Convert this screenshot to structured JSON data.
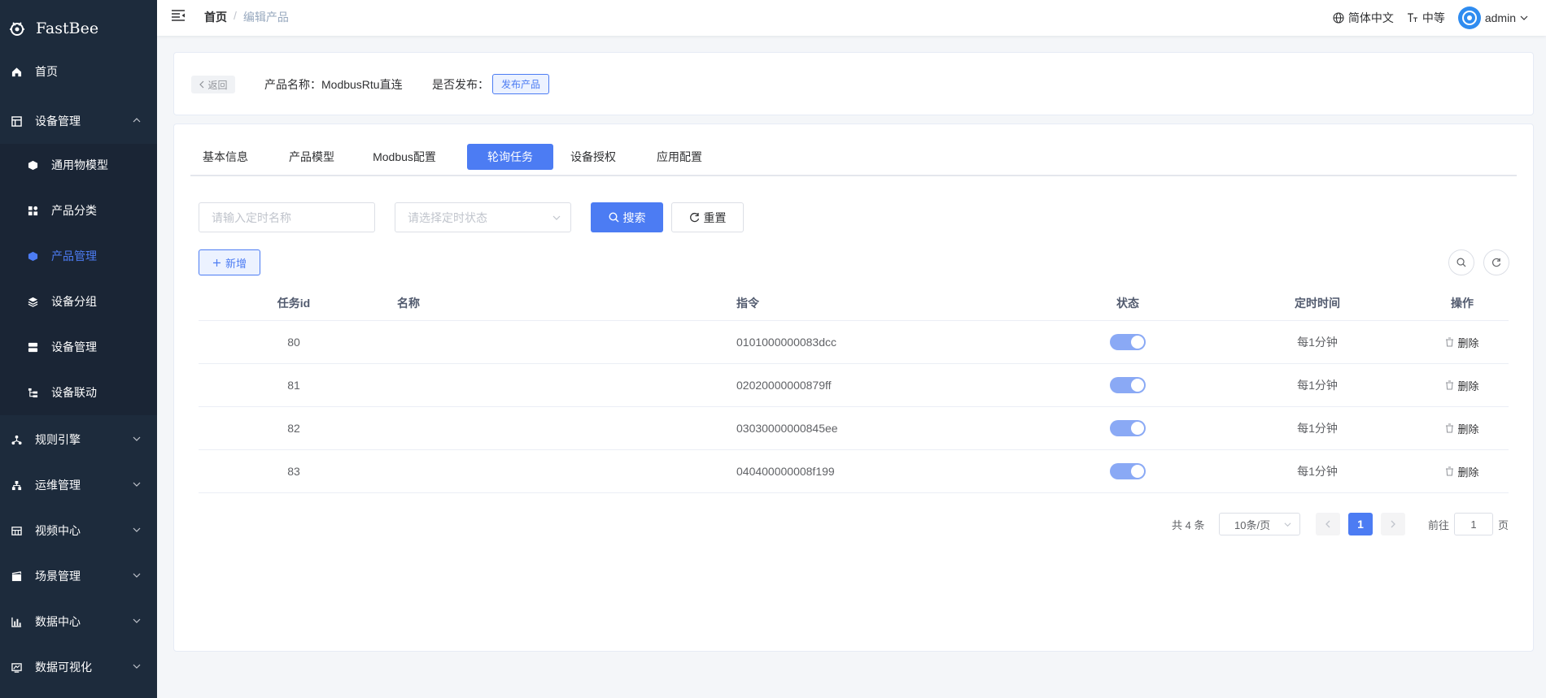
{
  "app": {
    "name": "FastBee"
  },
  "sidebar": {
    "items": [
      {
        "label": "首页",
        "icon": "home-icon"
      },
      {
        "label": "设备管理",
        "icon": "device-icon",
        "expanded": true
      },
      {
        "label": "通用物模型",
        "icon": "cube-icon"
      },
      {
        "label": "产品分类",
        "icon": "category-icon"
      },
      {
        "label": "产品管理",
        "icon": "product-icon",
        "active": true
      },
      {
        "label": "设备分组",
        "icon": "layers-icon"
      },
      {
        "label": "设备管理",
        "icon": "server-icon"
      },
      {
        "label": "设备联动",
        "icon": "link-icon"
      },
      {
        "label": "规则引擎",
        "icon": "rule-icon"
      },
      {
        "label": "运维管理",
        "icon": "ops-icon"
      },
      {
        "label": "视频中心",
        "icon": "video-icon"
      },
      {
        "label": "场景管理",
        "icon": "scene-icon"
      },
      {
        "label": "数据中心",
        "icon": "chart-icon"
      },
      {
        "label": "数据可视化",
        "icon": "monitor-icon"
      }
    ]
  },
  "header": {
    "breadcrumb": {
      "home": "首页",
      "sep": "/",
      "current": "编辑产品"
    },
    "language": "简体中文",
    "size": "中等",
    "user": "admin"
  },
  "product": {
    "back_label": "返回",
    "name_label": "产品名称：ModbusRtu直连",
    "publish_label": "是否发布：",
    "publish_button": "发布产品"
  },
  "tabs": [
    {
      "label": "基本信息"
    },
    {
      "label": "产品模型"
    },
    {
      "label": "Modbus配置"
    },
    {
      "label": "轮询任务",
      "active": true
    },
    {
      "label": "设备授权"
    },
    {
      "label": "应用配置"
    }
  ],
  "filters": {
    "name_placeholder": "请输入定时名称",
    "status_placeholder": "请选择定时状态",
    "search_label": "搜索",
    "reset_label": "重置",
    "add_label": "新增"
  },
  "table": {
    "columns": [
      "任务id",
      "名称",
      "指令",
      "状态",
      "定时时间",
      "操作"
    ],
    "rows": [
      {
        "id": "80",
        "name": "",
        "command": "0101000000083dcc",
        "enabled": true,
        "schedule": "每1分钟",
        "action": "删除"
      },
      {
        "id": "81",
        "name": "",
        "command": "02020000000879ff",
        "enabled": true,
        "schedule": "每1分钟",
        "action": "删除"
      },
      {
        "id": "82",
        "name": "",
        "command": "03030000000845ee",
        "enabled": true,
        "schedule": "每1分钟",
        "action": "删除"
      },
      {
        "id": "83",
        "name": "",
        "command": "040400000008f199",
        "enabled": true,
        "schedule": "每1分钟",
        "action": "删除"
      }
    ]
  },
  "pagination": {
    "total": "共 4 条",
    "page_size": "10条/页",
    "current_page": "1",
    "goto_prefix": "前往",
    "goto_value": "1",
    "goto_suffix": "页"
  },
  "colors": {
    "sidebar_bg": "#1d2b3c",
    "primary": "#4c7cf3",
    "switch_on": "#8aa9f5"
  }
}
